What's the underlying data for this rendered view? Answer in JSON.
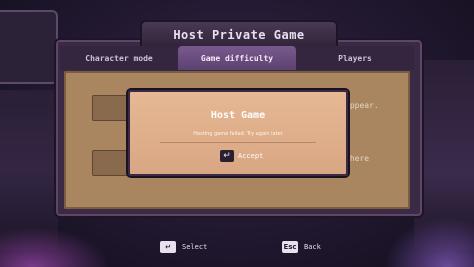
{
  "dialog_title": "Host Private Game",
  "tabs": [
    {
      "label": "Character mode",
      "active": false
    },
    {
      "label": "Game difficulty",
      "active": true
    },
    {
      "label": "Players",
      "active": false
    }
  ],
  "background_text": {
    "right_top": "appear.",
    "right_bottom": "There"
  },
  "modal": {
    "title": "Host Game",
    "message": "Hosting game failed. Try again later",
    "accept_label": "Accept",
    "accept_icon": "enter-key-icon"
  },
  "hints": [
    {
      "key_icon": "enter-key-icon",
      "label": "Select"
    },
    {
      "key": "Esc",
      "label": "Back"
    }
  ],
  "colors": {
    "modal_bg": "#e1b08c",
    "content_bg": "#a98660",
    "tab_active": "#6a4d7e",
    "panel": "#3a2a45"
  }
}
